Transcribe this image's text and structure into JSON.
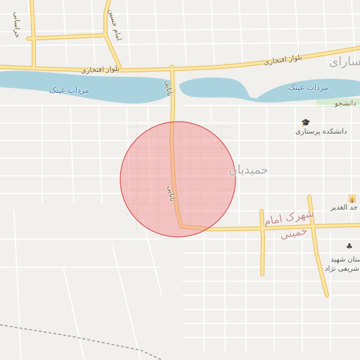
{
  "labels": {
    "water_1": "مرداب عینک",
    "water_2": "مرداب عینک",
    "road_eftekhari_1": "بلوار افتخاری",
    "road_eftekhari_2": "بلوار افتخاری",
    "road_imam_hossein": "امام حسین",
    "road_khorasani": "خراسانی",
    "road_bahar": "بابایی",
    "road_bahar_2": "بابایی",
    "road_daneshjoo": "دانشجو",
    "district_hamidian": "حمیدیان",
    "district_shahrak": "شهرک امام",
    "district_khomeini": "خمینی",
    "district_sari": "سارای",
    "poi_nursing_school": "دانشکده پرستاری",
    "poi_mosque": "جد الغدیر",
    "poi_park_1": "ستان شهید",
    "poi_park_2": "شریفی نژاد"
  },
  "icons": {
    "school": "mortarboard-icon",
    "mosque": "mosque-icon",
    "park": "tree-icon"
  },
  "colors": {
    "land": "#f2f0ed",
    "water": "#aad3df",
    "major_road": "#f7d98c",
    "minor_road": "#ffffff",
    "highlight_fill": "#f08a8a",
    "highlight_stroke": "#d45555"
  }
}
